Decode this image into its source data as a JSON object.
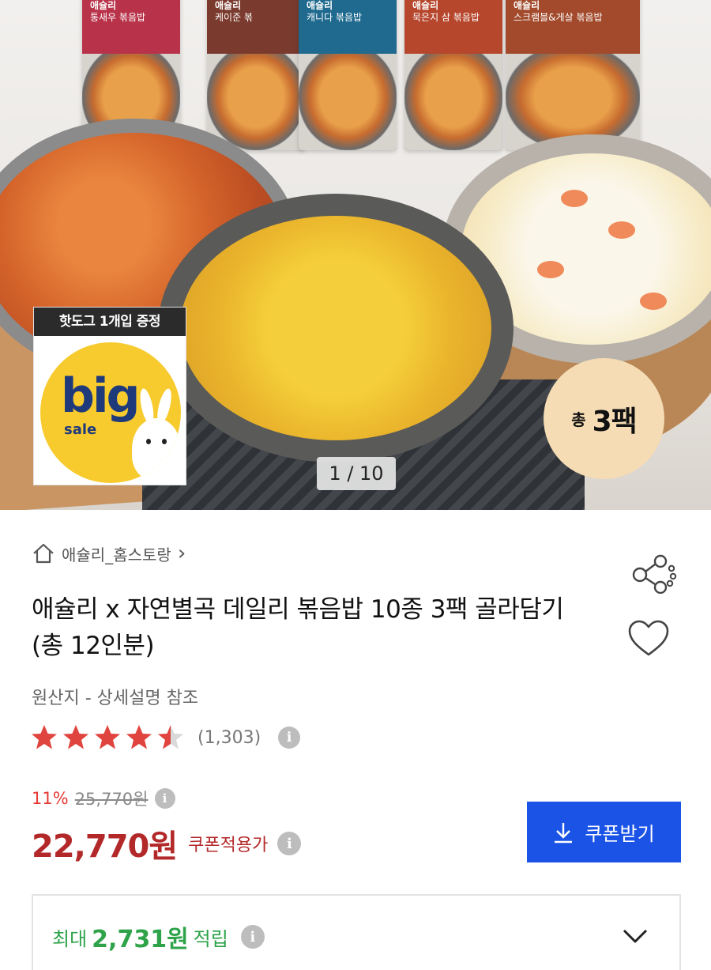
{
  "hero": {
    "packs": [
      {
        "brand": "애슐리",
        "name": "통새우 볶음밥"
      },
      {
        "brand": "애슐리",
        "name": "케이준 볶"
      },
      {
        "brand": "애슐리",
        "name": "캐니다 볶음밥"
      },
      {
        "brand": "애슐리",
        "name": "묵은지 삼 볶음밥"
      },
      {
        "brand": "애슐리",
        "name": "스크램블&게살 볶음밥"
      }
    ],
    "promo_label": "핫도그 1개입 증정",
    "promo_big": "big",
    "promo_sale": "sale",
    "pack_count_prefix": "총",
    "pack_count_value": "3팩",
    "pager": "1 / 10"
  },
  "store": {
    "name": "애슐리_홈스토랑",
    "icon": "home-icon",
    "chevron": "›"
  },
  "product": {
    "title": "애슐리 x 자연별곡 데일리 볶음밥 10종 3팩 골라담기 (총 12인분)",
    "origin": "원산지 - 상세설명 참조",
    "rating_value": 4.5,
    "rating_max": 5,
    "review_count": "(1,303)",
    "info_glyph": "i"
  },
  "price": {
    "discount_rate": "11%",
    "original_price": "25,770원",
    "sale_price": "22,770원",
    "coupon_note": "쿠폰적용가"
  },
  "coupon_button": {
    "label": "쿠폰받기",
    "icon": "download-icon"
  },
  "reward": {
    "prefix": "최대",
    "amount": "2,731원",
    "suffix": "적립"
  },
  "colors": {
    "accent_blue": "#1a53e6",
    "price_red": "#b3292a",
    "discount_red": "#e53935",
    "star_red": "#e0443e",
    "reward_green": "#2ea34a"
  }
}
